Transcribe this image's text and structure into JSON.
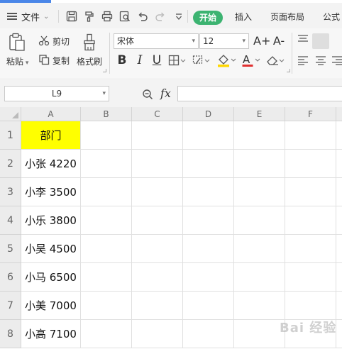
{
  "titlebar": {
    "file_menu_label": "文件",
    "file_menu_icon": "hamburger-menu-icon",
    "quick_access_icons": [
      "save-icon",
      "format-painter-icon",
      "print-icon",
      "print-preview-icon",
      "undo-icon",
      "redo-icon",
      "customize-dropdown-icon"
    ],
    "tabs": [
      "开始",
      "插入",
      "页面布局",
      "公式"
    ],
    "active_tab": "开始",
    "accent_color": "#3cb371"
  },
  "ribbon": {
    "paste_label": "粘贴",
    "cut_label": "剪切",
    "copy_label": "复制",
    "format_painter_label": "格式刷",
    "font_name": "宋体",
    "font_size": "12",
    "font_increase_glyph": "A+",
    "font_decrease_glyph": "A-",
    "bold_glyph": "B",
    "italic_glyph": "I",
    "underline_glyph": "U",
    "font_color_glyph": "A",
    "font_color_hex": "#e03030",
    "fill_color_hex": "#ffd700"
  },
  "formula_bar": {
    "name_box_value": "L9",
    "fx_label": "fx",
    "formula_value": ""
  },
  "sheet": {
    "column_headers": [
      "A",
      "B",
      "C",
      "D",
      "E",
      "F"
    ],
    "row_headers": [
      "1",
      "2",
      "3",
      "4",
      "5",
      "6",
      "7",
      "8"
    ],
    "column_a": [
      "部门",
      "小张 4220",
      "小李 3500",
      "小乐 3800",
      "小吴 4500",
      "小马 6500",
      "小美 7000",
      "小高 7100"
    ],
    "header_fill_hex": "#ffff00"
  },
  "watermark": "Bai 经验"
}
